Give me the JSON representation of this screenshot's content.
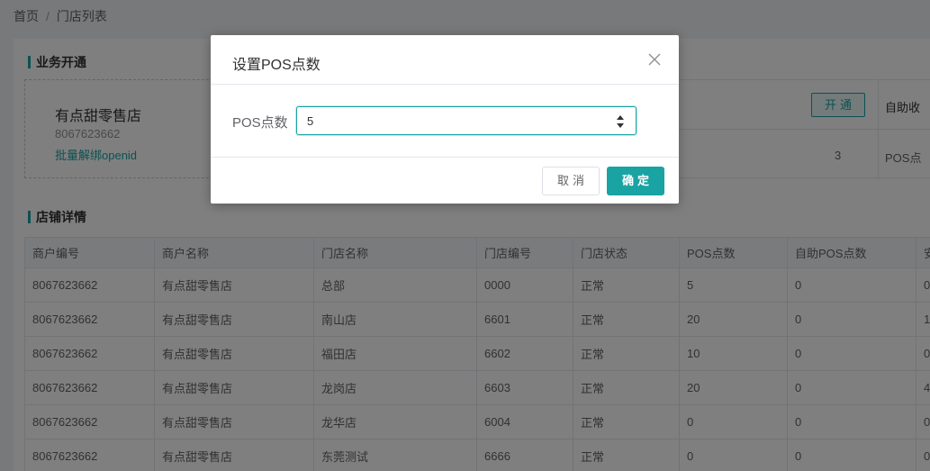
{
  "breadcrumb": {
    "home": "首页",
    "separator": "/",
    "current": "门店列表"
  },
  "business": {
    "section_title": "业务开通",
    "shop_name": "有点甜零售店",
    "shop_code": "8067623662",
    "unbind_link": "批量解绑openid",
    "open_button": "开通",
    "self_service_header": "自助收",
    "pos_count": "3",
    "pos_label": "POS点"
  },
  "store_details": {
    "section_title": "店铺详情",
    "columns": [
      "商户编号",
      "商户名称",
      "门店名称",
      "门店编号",
      "门店状态",
      "POS点数",
      "自助POS点数",
      "安"
    ],
    "rows": [
      [
        "8067623662",
        "有点甜零售店",
        "总部",
        "0000",
        "正常",
        "5",
        "0",
        "0"
      ],
      [
        "8067623662",
        "有点甜零售店",
        "南山店",
        "6601",
        "正常",
        "20",
        "0",
        "1"
      ],
      [
        "8067623662",
        "有点甜零售店",
        "福田店",
        "6602",
        "正常",
        "10",
        "0",
        "0"
      ],
      [
        "8067623662",
        "有点甜零售店",
        "龙岗店",
        "6603",
        "正常",
        "20",
        "0",
        "4"
      ],
      [
        "8067623662",
        "有点甜零售店",
        "龙华店",
        "6004",
        "正常",
        "0",
        "0",
        "0"
      ],
      [
        "8067623662",
        "有点甜零售店",
        "东莞测试",
        "6666",
        "正常",
        "0",
        "0",
        "0"
      ]
    ]
  },
  "dialog": {
    "title": "设置POS点数",
    "field_label": "POS点数",
    "field_value": "5",
    "cancel_button": "取消",
    "ok_button": "确定"
  },
  "colors": {
    "accent": "#1aa3a3",
    "overlay": "rgba(0,0,0,0.5)"
  }
}
